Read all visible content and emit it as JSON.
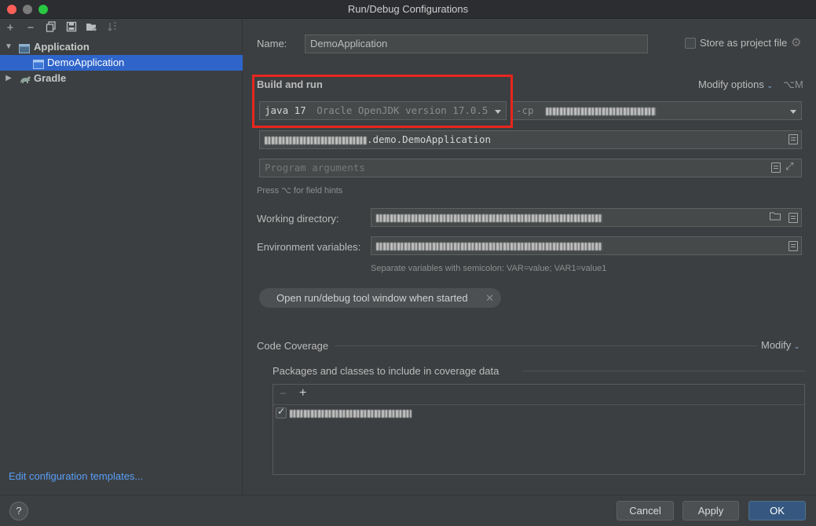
{
  "window": {
    "title": "Run/Debug Configurations"
  },
  "toolbar": {
    "icons": [
      "add-icon",
      "remove-icon",
      "copy-icon",
      "save-icon",
      "new-folder-icon",
      "sort-icon"
    ]
  },
  "tree": {
    "application": {
      "label": "Application"
    },
    "demo": {
      "label": "DemoApplication"
    },
    "gradle": {
      "label": "Gradle"
    }
  },
  "left_footer": {
    "edit_templates": "Edit configuration templates..."
  },
  "name_row": {
    "label": "Name:",
    "value": "DemoApplication",
    "store_label": "Store as project file"
  },
  "build": {
    "heading": "Build and run",
    "modify_options": "Modify options",
    "modify_shortcut": "⌥M",
    "jdk_main": "java 17",
    "jdk_detail": "Oracle OpenJDK version 17.0.5",
    "cp_label": "-cp",
    "main_class_suffix": ".demo.DemoApplication",
    "program_args_placeholder": "Program arguments",
    "field_hint": "Press ⌥ for field hints"
  },
  "working_dir": {
    "label": "Working directory:"
  },
  "env": {
    "label": "Environment variables:",
    "hint": "Separate variables with semicolon: VAR=value; VAR1=value1"
  },
  "chip": {
    "label": "Open run/debug tool window when started"
  },
  "coverage": {
    "heading": "Code Coverage",
    "modify": "Modify",
    "packages_label": "Packages and classes to include in coverage data"
  },
  "footer": {
    "help": "?",
    "cancel": "Cancel",
    "apply": "Apply",
    "ok": "OK"
  },
  "colors": {
    "accent": "#589df6",
    "selection": "#2f65ca",
    "highlight_box": "#e8261d",
    "primary_button": "#365880"
  }
}
